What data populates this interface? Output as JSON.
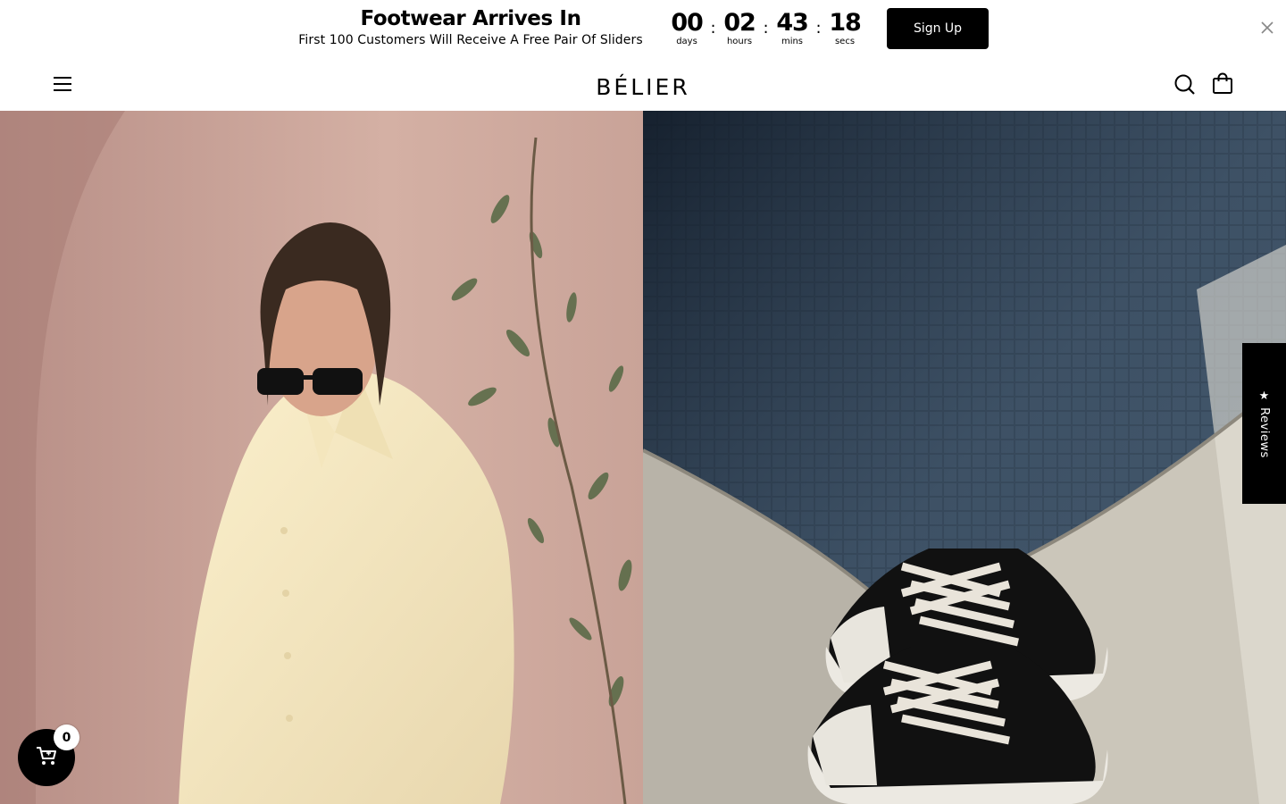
{
  "announcement": {
    "title": "Footwear Arrives In",
    "subtitle": "First 100 Customers Will Receive A Free Pair Of Sliders",
    "countdown": [
      {
        "value": "00",
        "label": "days"
      },
      {
        "value": "02",
        "label": "hours"
      },
      {
        "value": "43",
        "label": "mins"
      },
      {
        "value": "18",
        "label": "secs"
      }
    ],
    "separator": ":",
    "signup_label": "Sign Up",
    "close_icon": "close-icon"
  },
  "header": {
    "logo": "BÉLIER",
    "menu_icon": "hamburger-menu-icon",
    "search_icon": "search-icon",
    "cart_icon": "shopping-bag-icon"
  },
  "hero": {
    "left_image": "man-in-linen-shirt-photo",
    "right_image": "sneakers-by-pool-photo"
  },
  "reviews_tab": {
    "label": "★ Reviews"
  },
  "floating_cart": {
    "count": "0",
    "icon": "cart-icon"
  },
  "colors": {
    "primary": "#000000",
    "background": "#ffffff",
    "hero_left_bg": "#c6a298",
    "hero_right_bg": "#3a4a5a"
  }
}
